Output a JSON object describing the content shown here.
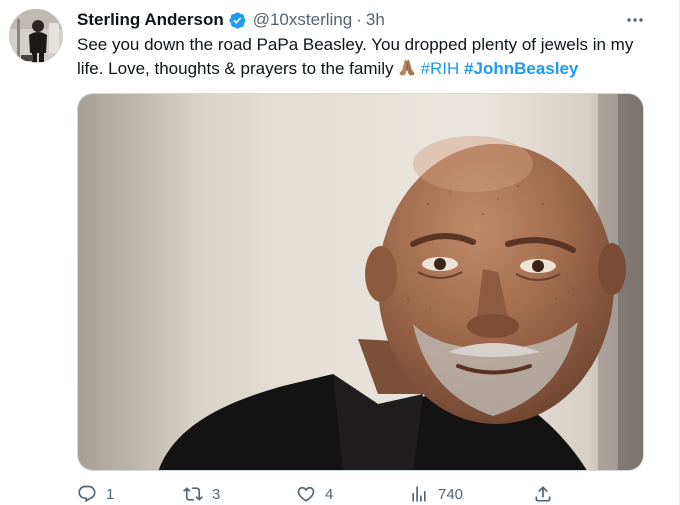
{
  "author": {
    "display_name": "Sterling Anderson",
    "handle": "@10xsterling",
    "separator": "·",
    "timestamp": "3h"
  },
  "tweet": {
    "text_main": "See you down the road PaPa Beasley. You dropped plenty of jewels in my life. Love, thoughts & prayers to the family",
    "emoji": "folded-hands-icon",
    "hashtags": [
      "#RIH",
      "#JohnBeasley"
    ]
  },
  "actions": {
    "reply_count": "1",
    "retweet_count": "3",
    "like_count": "4",
    "views_count": "740"
  },
  "colors": {
    "accent": "#1d9bf0",
    "verified": "#1d9bf0",
    "secondary_text": "#536471"
  }
}
